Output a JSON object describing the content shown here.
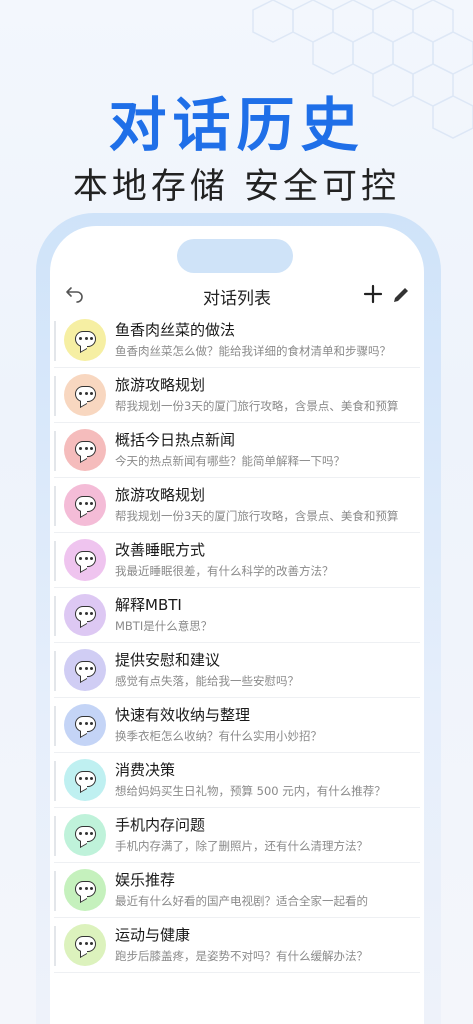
{
  "headline": "对话历史",
  "subline": "本地存储 安全可控",
  "nav": {
    "title": "对话列表",
    "icons": {
      "back": "undo-icon",
      "add": "plus-icon",
      "edit": "pencil-icon"
    }
  },
  "items": [
    {
      "title": "鱼香肉丝菜的做法",
      "desc": "鱼香肉丝菜怎么做？能给我详细的食材清单和步骤吗？",
      "color": "#f6efa3"
    },
    {
      "title": "旅游攻略规划",
      "desc": "帮我规划一份3天的厦门旅行攻略，含景点、美食和预算",
      "color": "#f8d7c0"
    },
    {
      "title": "概括今日热点新闻",
      "desc": "今天的热点新闻有哪些？能简单解释一下吗？",
      "color": "#f5bcbc"
    },
    {
      "title": "旅游攻略规划",
      "desc": "帮我规划一份3天的厦门旅行攻略，含景点、美食和预算",
      "color": "#f4bcd7"
    },
    {
      "title": "改善睡眠方式",
      "desc": "我最近睡眠很差，有什么科学的改善方法？",
      "color": "#efc4ef"
    },
    {
      "title": "解释MBTI",
      "desc": "MBTI是什么意思？",
      "color": "#ddc8f3"
    },
    {
      "title": "提供安慰和建议",
      "desc": "感觉有点失落，能给我一些安慰吗？",
      "color": "#d0cdf4"
    },
    {
      "title": "快速有效收纳与整理",
      "desc": "换季衣柜怎么收纳？有什么实用小妙招？",
      "color": "#c4d4f6"
    },
    {
      "title": "消费决策",
      "desc": "想给妈妈买生日礼物，预算 500 元内，有什么推荐？",
      "color": "#bff0f1"
    },
    {
      "title": "手机内存问题",
      "desc": "手机内存满了，除了删照片，还有什么清理方法？",
      "color": "#bff2da"
    },
    {
      "title": "娱乐推荐",
      "desc": "最近有什么好看的国产电视剧？适合全家一起看的",
      "color": "#c5f1bd"
    },
    {
      "title": "运动与健康",
      "desc": "跑步后膝盖疼，是姿势不对吗？有什么缓解办法？",
      "color": "#dcf2bd"
    }
  ]
}
